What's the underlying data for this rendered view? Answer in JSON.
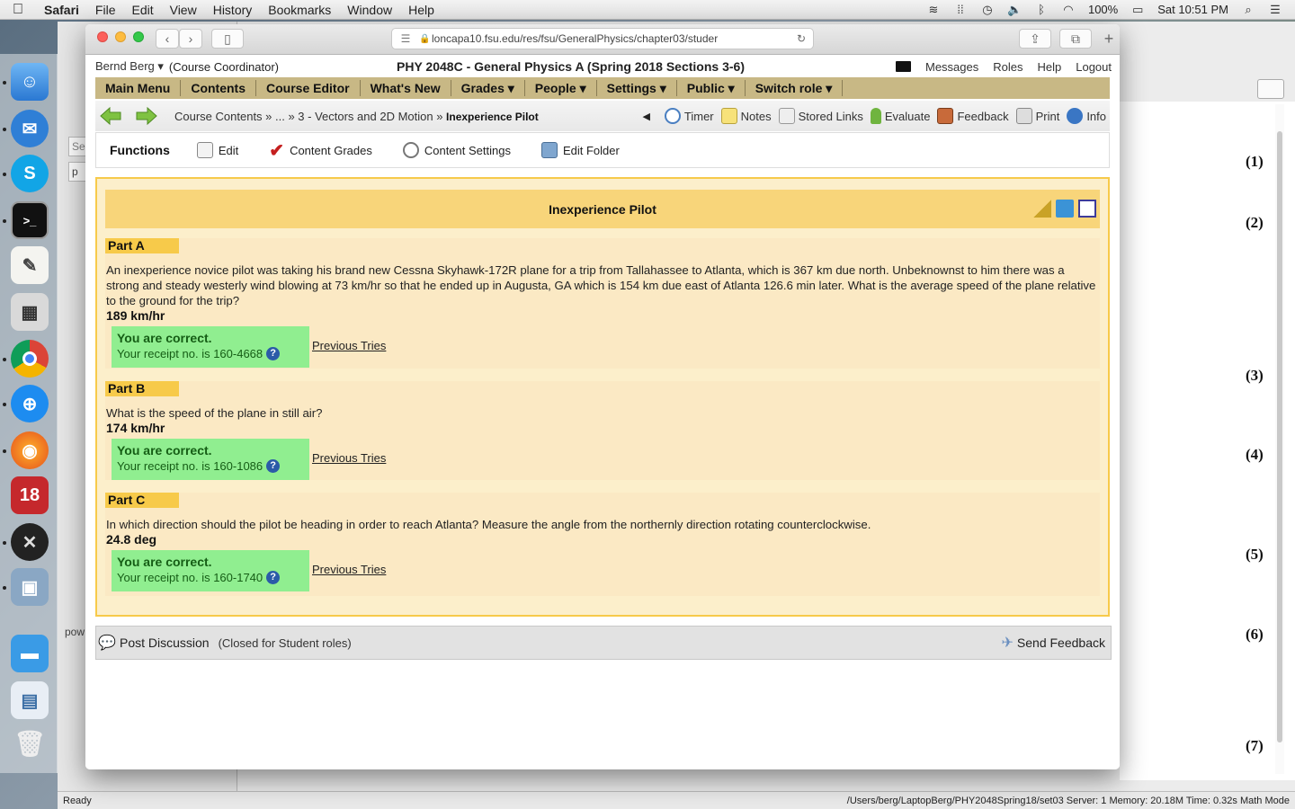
{
  "menubar": {
    "app": "Safari",
    "items": [
      "File",
      "Edit",
      "View",
      "History",
      "Bookmarks",
      "Window",
      "Help"
    ],
    "battery": "100%",
    "clock": "Sat 10:51 PM"
  },
  "browser": {
    "url": "loncapa10.fsu.edu/res/fsu/GeneralPhysics/chapter03/studer"
  },
  "header": {
    "user": "Bernd Berg ▾",
    "role": "(Course Coordinator)",
    "course": "PHY 2048C - General Physics A (Spring 2018 Sections 3-6)",
    "links": [
      "Messages",
      "Roles",
      "Help",
      "Logout"
    ]
  },
  "mainmenu": [
    "Main Menu",
    "Contents",
    "Course Editor",
    "What's New",
    "Grades ▾",
    "People ▾",
    "Settings ▾",
    "Public ▾",
    "Switch role ▾"
  ],
  "nav": {
    "crumb_prefix": "Course Contents » ... » 3 - Vectors and 2D Motion » ",
    "crumb_current": "Inexperience Pilot",
    "tools": [
      "Timer",
      "Notes",
      "Stored Links",
      "Evaluate",
      "Feedback",
      "Print",
      "Info"
    ]
  },
  "functions": {
    "title": "Functions",
    "items": [
      "Edit",
      "Content Grades",
      "Content Settings",
      "Edit Folder"
    ]
  },
  "problem": {
    "title": "Inexperience Pilot",
    "parts": [
      {
        "label": "Part A",
        "text": "An inexperience novice pilot was taking his brand new Cessna Skyhawk-172R plane for a trip from Tallahassee to Atlanta, which is 367 km due north. Unbeknownst to him there was a strong and steady westerly wind blowing at 73 km/hr so that he ended up in Augusta, GA which is 154 km due east of Atlanta 126.6 min later. What is the average speed of the plane relative to the ground for the trip?",
        "answer": "189 km/hr",
        "status": "You are correct.",
        "receipt": "Your receipt no. is 160-4668",
        "prev": "Previous Tries"
      },
      {
        "label": "Part B",
        "text": "What is the speed of the plane in still air?",
        "answer": "174 km/hr",
        "status": "You are correct.",
        "receipt": "Your receipt no. is 160-1086",
        "prev": "Previous Tries"
      },
      {
        "label": "Part C",
        "text": "In which direction should the pilot be heading in order to reach Atlanta? Measure the angle from the northernly direction rotating counterclockwise.",
        "answer": "24.8 deg",
        "status": "You are correct.",
        "receipt": "Your receipt no. is 160-1740",
        "prev": "Previous Tries"
      }
    ]
  },
  "discussion": {
    "post": "Post Discussion",
    "closed": "(Closed for Student roles)",
    "send": "Send Feedback"
  },
  "background": {
    "eq_numbers": [
      "(1)",
      "(2)",
      "(3)",
      "(4)",
      "(5)",
      "(6)",
      "(7)"
    ],
    "left_labels": [
      "Sea",
      "p",
      "pow"
    ],
    "status_ready": "Ready",
    "status_path": "/Users/berg/LaptopBerg/PHY2048Spring18/set03   Server: 1   Memory: 20.18M   Time: 0.32s   Math Mode"
  }
}
